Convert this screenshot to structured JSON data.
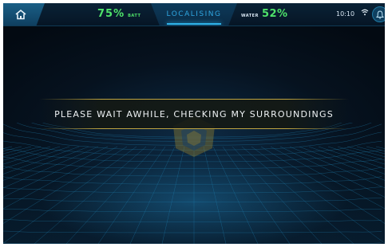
{
  "topbar": {
    "home_icon": "home-icon",
    "battery_value": "75%",
    "battery_label": "BATT",
    "status": "LOCALISING",
    "water_label": "WATER",
    "water_value": "52%",
    "time": "10:10",
    "wifi_icon": "wifi-icon",
    "alert_icon": "bell-icon"
  },
  "main": {
    "message": "PLEASE WAIT AWHILE, CHECKING MY SURROUNDINGS",
    "logo_icon": "hexagon-logo-icon"
  },
  "colors": {
    "accent_green": "#4fe36a",
    "accent_blue": "#2fa6e0",
    "band_gold": "#d2b446"
  }
}
